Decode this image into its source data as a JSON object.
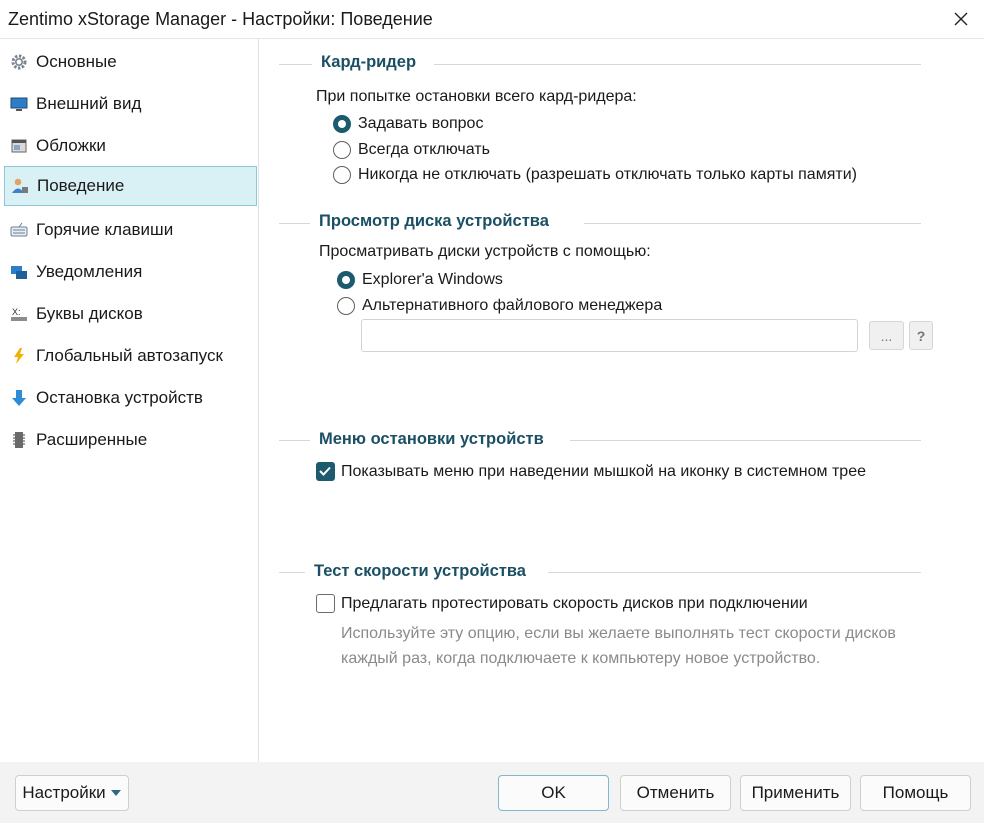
{
  "window": {
    "title": "Zentimo xStorage Manager - Настройки: Поведение",
    "close_icon": "close-icon"
  },
  "sidebar": {
    "items": [
      {
        "label": "Основные",
        "icon": "gear-icon"
      },
      {
        "label": "Внешний вид",
        "icon": "monitor-icon"
      },
      {
        "label": "Обложки",
        "icon": "skin-window-icon"
      },
      {
        "label": "Поведение",
        "icon": "user-behavior-icon",
        "active": true
      },
      {
        "label": "Горячие клавиши",
        "icon": "keyboard-icon"
      },
      {
        "label": "Уведомления",
        "icon": "notification-icon"
      },
      {
        "label": "Буквы дисков",
        "icon": "drive-letter-icon"
      },
      {
        "label": "Глобальный автозапуск",
        "icon": "lightning-icon"
      },
      {
        "label": "Остановка устройств",
        "icon": "down-arrow-icon"
      },
      {
        "label": "Расширенные",
        "icon": "chip-icon"
      }
    ]
  },
  "card_reader": {
    "title": "Кард-ридер",
    "prompt": "При попытке остановки всего кард-ридера:",
    "options": [
      {
        "label": "Задавать вопрос",
        "checked": true
      },
      {
        "label": "Всегда отключать",
        "checked": false
      },
      {
        "label": "Никогда не отключать (разрешать отключать только карты памяти)",
        "checked": false
      }
    ]
  },
  "disk_view": {
    "title": "Просмотр диска устройства",
    "prompt": "Просматривать диски устройств с помощью:",
    "options": [
      {
        "label": "Explorer'a Windows",
        "checked": true
      },
      {
        "label": "Альтернативного файлового менеджера",
        "checked": false
      }
    ],
    "path_value": "",
    "browse_label": "...",
    "help_label": "?"
  },
  "stop_menu": {
    "title": "Меню остановки устройств",
    "checkbox_label": "Показывать меню при наведении мышкой на иконку в системном трее",
    "checked": true
  },
  "speed_test": {
    "title": "Тест скорости устройства",
    "checkbox_label": "Предлагать протестировать скорость дисков при подключении",
    "checked": false,
    "hint_line1": "Используйте эту опцию, если вы желаете выполнять тест скорости дисков",
    "hint_line2": "каждый раз, когда подключаете к компьютеру новое устройство."
  },
  "footer": {
    "settings_label": "Настройки",
    "ok_label": "OK",
    "cancel_label": "Отменить",
    "apply_label": "Применить",
    "help_label": "Помощь"
  },
  "colors": {
    "accent": "#1c5a6e",
    "group_title": "#1b4f64",
    "selection": "#d9f0f5"
  }
}
